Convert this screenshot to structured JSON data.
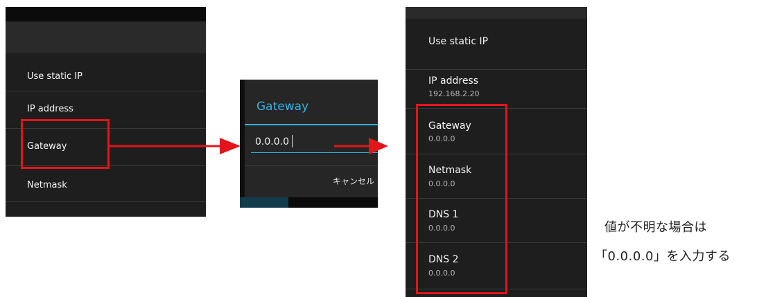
{
  "left_panel": {
    "items": [
      {
        "label": "Use static IP"
      },
      {
        "label": "IP address"
      },
      {
        "label": "Gateway"
      },
      {
        "label": "Netmask"
      }
    ]
  },
  "dialog": {
    "title": "Gateway",
    "input_value": "0.0.0.0",
    "cancel_label": "キャンセル"
  },
  "right_panel": {
    "items": [
      {
        "label": "Use static IP",
        "value": ""
      },
      {
        "label": "IP address",
        "value": "192.168.2.20"
      },
      {
        "label": "Gateway",
        "value": "0.0.0.0"
      },
      {
        "label": "Netmask",
        "value": "0.0.0.0"
      },
      {
        "label": "DNS 1",
        "value": "0.0.0.0"
      },
      {
        "label": "DNS 2",
        "value": "0.0.0.0"
      }
    ]
  },
  "note": {
    "line1": "値が不明な場合は",
    "line2": "「0.0.0.0」を入力する"
  },
  "colors": {
    "highlight": "#e4141b",
    "accent": "#33b5e5",
    "panel_bg": "#1e1e1e"
  }
}
